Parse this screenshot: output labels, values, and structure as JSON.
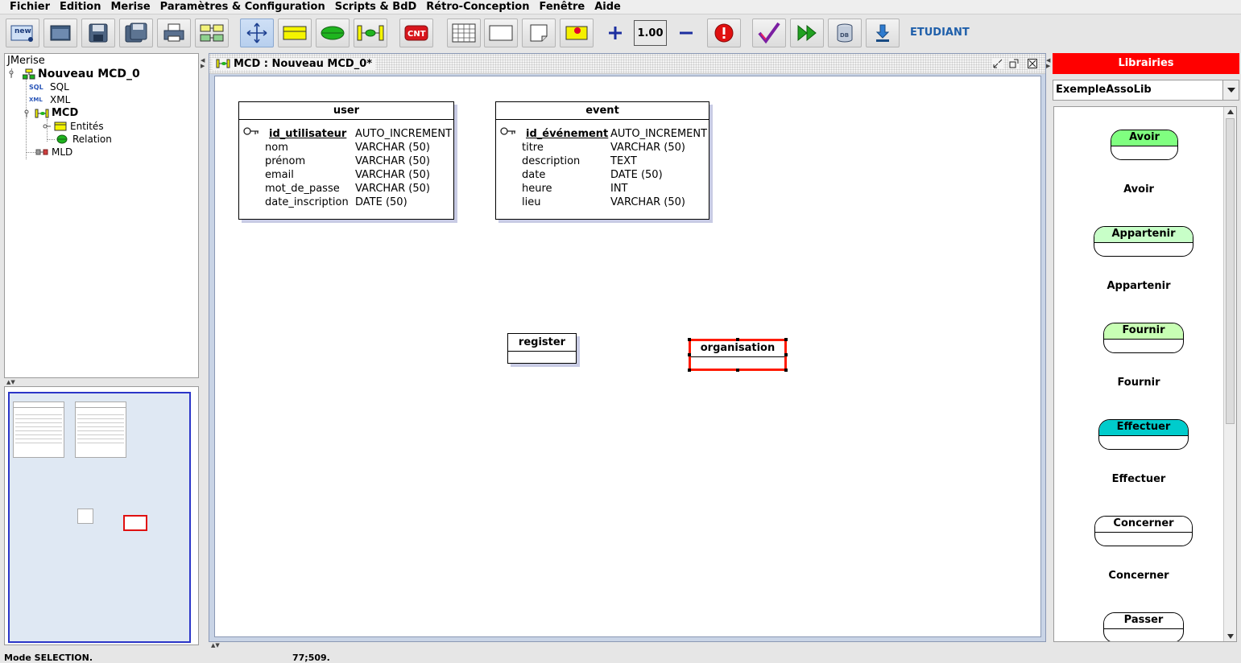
{
  "menu": [
    "Fichier",
    "Edition",
    "Merise",
    "Paramètres & Configuration",
    "Scripts & BdD",
    "Rétro-Conception",
    "Fenêtre",
    "Aide"
  ],
  "toolbar": {
    "zoom": "1.00",
    "new_label": "new",
    "cnt_label": "CNT",
    "db_label": "DB",
    "profile": "ETUDIANT"
  },
  "tree": {
    "root": "JMerise",
    "project": "Nouveau MCD_0",
    "sql": "SQL",
    "xml": "XML",
    "mcd": "MCD",
    "entities": "Entités",
    "relation": "Relation",
    "mld": "MLD",
    "sql_badge": "SQL",
    "xml_badge": "XML"
  },
  "document": {
    "title": "MCD : Nouveau MCD_0*"
  },
  "entities": {
    "user": {
      "name": "user",
      "attributes": [
        {
          "name": "id_utilisateur",
          "type": "AUTO_INCREMENT"
        },
        {
          "name": "nom",
          "type": "VARCHAR (50)"
        },
        {
          "name": "prénom",
          "type": "VARCHAR (50)"
        },
        {
          "name": "email",
          "type": "VARCHAR (50)"
        },
        {
          "name": "mot_de_passe",
          "type": "VARCHAR (50)"
        },
        {
          "name": "date_inscription",
          "type": "DATE (50)"
        }
      ]
    },
    "event": {
      "name": "event",
      "attributes": [
        {
          "name": "id_événement",
          "type": "AUTO_INCREMENT"
        },
        {
          "name": "titre",
          "type": "VARCHAR (50)"
        },
        {
          "name": "description",
          "type": "TEXT"
        },
        {
          "name": "date",
          "type": "DATE (50)"
        },
        {
          "name": "heure",
          "type": "INT"
        },
        {
          "name": "lieu",
          "type": "VARCHAR (50)"
        }
      ]
    },
    "register": {
      "name": "register"
    },
    "organisation": {
      "name": "organisation"
    }
  },
  "library": {
    "header": "Librairies",
    "selected": "ExempleAssoLib",
    "items": [
      {
        "name": "Avoir",
        "caption": "Avoir",
        "color": "#80ff80"
      },
      {
        "name": "Appartenir",
        "caption": "Appartenir",
        "color": "#c8ffc8"
      },
      {
        "name": "Fournir",
        "caption": "Fournir",
        "color": "#c8ffb4"
      },
      {
        "name": "Effectuer",
        "caption": "Effectuer",
        "color": "#00cccc"
      },
      {
        "name": "Concerner",
        "caption": "Concerner",
        "color": "#ffffff"
      },
      {
        "name": "Passer",
        "caption": "Passer",
        "color": "#ffffff"
      }
    ]
  },
  "status": {
    "mode": "Mode SELECTION.",
    "coords": "77;509."
  }
}
